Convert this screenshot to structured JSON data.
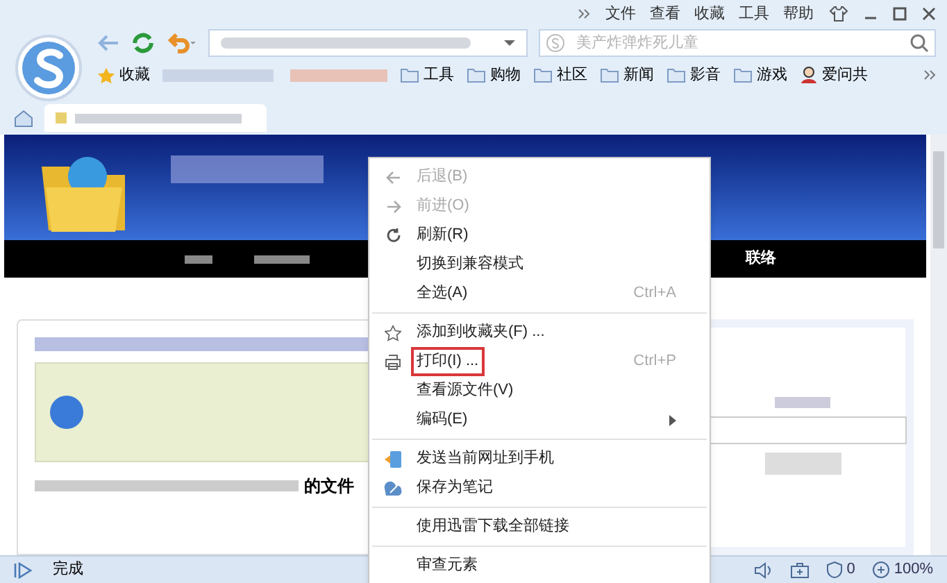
{
  "menu_bar": [
    "文件",
    "查看",
    "收藏",
    "工具",
    "帮助"
  ],
  "search": {
    "placeholder": "美产炸弹炸死儿童"
  },
  "bookmarks": [
    {
      "label": "收藏",
      "kind": "star"
    },
    {
      "label": "工具",
      "kind": "folder"
    },
    {
      "label": "购物",
      "kind": "folder"
    },
    {
      "label": "社区",
      "kind": "folder"
    },
    {
      "label": "新闻",
      "kind": "folder"
    },
    {
      "label": "影音",
      "kind": "folder"
    },
    {
      "label": "游戏",
      "kind": "folder"
    },
    {
      "label": "爱问共",
      "kind": "person"
    }
  ],
  "page": {
    "nav_link": "联络",
    "snippet": "的文件"
  },
  "context_menu": [
    {
      "kind": "item",
      "label": "后退(B)",
      "disabled": true,
      "highlighted": false
    },
    {
      "kind": "item",
      "label": "前进(O)",
      "disabled": true,
      "highlighted": false
    },
    {
      "kind": "item",
      "label": "刷新(R)",
      "disabled": false,
      "highlighted": false
    },
    {
      "kind": "item",
      "label": "切换到兼容模式",
      "disabled": false,
      "highlighted": false
    },
    {
      "kind": "item",
      "label": "全选(A)",
      "shortcut": "Ctrl+A",
      "disabled": false,
      "highlighted": false
    },
    {
      "kind": "separator"
    },
    {
      "kind": "item",
      "label": "添加到收藏夹(F) ...",
      "disabled": false,
      "highlighted": false
    },
    {
      "kind": "item",
      "label": "打印(I) ...",
      "shortcut": "Ctrl+P",
      "disabled": false,
      "highlighted": true
    },
    {
      "kind": "item",
      "label": "查看源文件(V)",
      "disabled": false,
      "highlighted": false
    },
    {
      "kind": "item",
      "label": "编码(E)",
      "submenu": true,
      "disabled": false,
      "highlighted": false
    },
    {
      "kind": "separator"
    },
    {
      "kind": "item",
      "label": "发送当前网址到手机",
      "disabled": false,
      "highlighted": false
    },
    {
      "kind": "item",
      "label": "保存为笔记",
      "disabled": false,
      "highlighted": false
    },
    {
      "kind": "separator"
    },
    {
      "kind": "item",
      "label": "使用迅雷下载全部链接",
      "disabled": false,
      "highlighted": false
    },
    {
      "kind": "separator"
    },
    {
      "kind": "item",
      "label": "审查元素",
      "disabled": false,
      "highlighted": false
    }
  ],
  "status_bar": {
    "text": "完成",
    "blocked_count": "0",
    "zoom": "100%"
  }
}
